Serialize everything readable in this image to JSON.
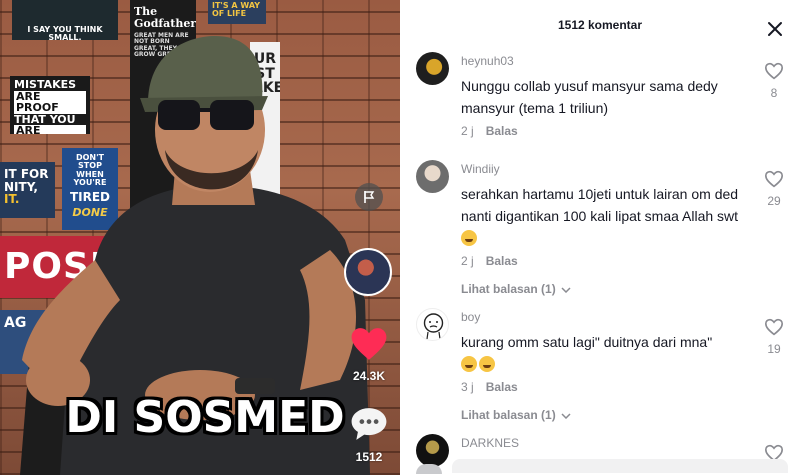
{
  "video": {
    "posters": {
      "p1": "I SAY YOU THINK SMALL.",
      "p2_title": "The Godfather",
      "p2_sub": "GREAT MEN ARE NOT BORN GREAT, THEY GROW GREAT.",
      "p3": "IT'S A WAY OF LIFE",
      "p4": [
        "MISTAKES",
        "ARE PROOF",
        "THAT YOU",
        "ARE TRYING"
      ],
      "p5_a": "IT FOR",
      "p5_b": "NITY,",
      "p5_c": "IT.",
      "p6_a": "DON'T STOP",
      "p6_b": "WHEN YOU'RE",
      "p6_c": "TIRED",
      "p6_d": "DONE",
      "p7": "POSITIV",
      "p8": "AG",
      "p9": "UR ST AKE"
    },
    "caption": "DI SOSMED",
    "like_count": "24.3K",
    "comment_count": "1512",
    "colors": {
      "like": "#fe2c55"
    }
  },
  "panel": {
    "title": "1512 komentar",
    "comments": [
      {
        "username": "heynuh03",
        "text": "Nunggu collab yusuf mansyur sama dedy mansyur (tema 1 triliun)",
        "time": "2 j",
        "reply_label": "Balas",
        "likes": "8",
        "view_replies": ""
      },
      {
        "username": "Windiiy",
        "text": "serahkan hartamu 10jeti untuk lairan om ded nanti digantikan 100 kali lipat smaa Allah swt",
        "time": "2 j",
        "reply_label": "Balas",
        "likes": "29",
        "view_replies": "Lihat balasan (1)"
      },
      {
        "username": "boy",
        "text": "kurang omm satu lagi\" duitnya dari mna\"",
        "time": "3 j",
        "reply_label": "Balas",
        "likes": "19",
        "view_replies": "Lihat balasan (1)"
      },
      {
        "username": "DARKNES",
        "text": "",
        "time": "",
        "reply_label": "",
        "likes": "",
        "view_replies": ""
      }
    ]
  }
}
